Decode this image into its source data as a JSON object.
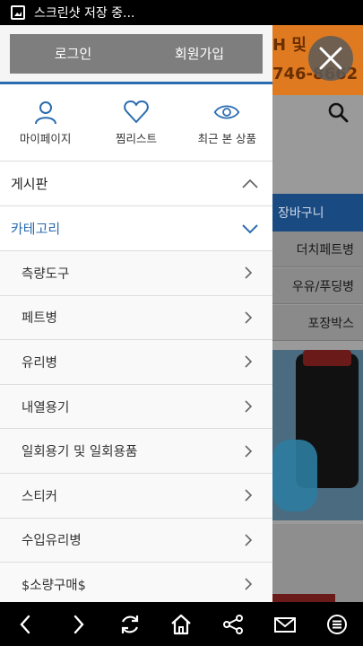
{
  "status_bar": {
    "text": "스크린샷 저장 중..."
  },
  "background": {
    "banner_line1": "H 및",
    "banner_line2": "746-8662",
    "cart_label": "장바구니",
    "categories": [
      "더치페트병",
      "우유/푸딩병",
      "포장박스"
    ]
  },
  "drawer": {
    "login_label": "로그인",
    "signup_label": "회원가입",
    "quick_links": [
      {
        "label": "마이페이지",
        "icon": "person-icon"
      },
      {
        "label": "찜리스트",
        "icon": "heart-icon"
      },
      {
        "label": "최근 본 상품",
        "icon": "eye-icon"
      }
    ],
    "board_label": "게시판",
    "category_label": "카테고리",
    "category_items": [
      "측량도구",
      "페트병",
      "유리병",
      "내열용기",
      "일회용기 및 일회용품",
      "스티커",
      "수입유리병",
      "$소량구매$"
    ]
  },
  "colors": {
    "accent": "#2b6cb0",
    "auth_button": "#7e7e7e"
  }
}
